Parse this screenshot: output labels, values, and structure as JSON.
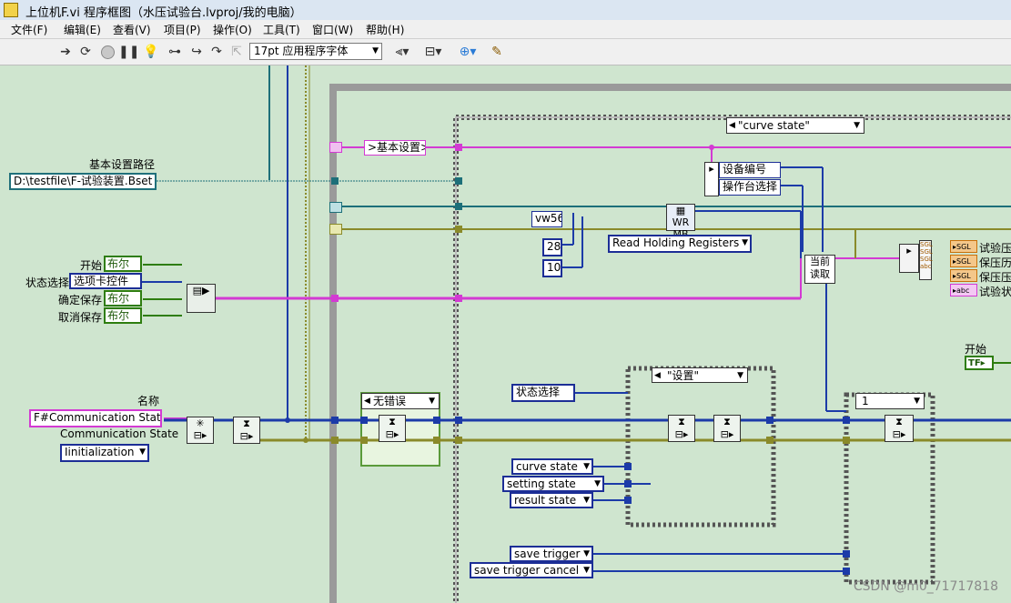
{
  "window": {
    "title": "上位机F.vi 程序框图（水压试验台.lvproj/我的电脑）"
  },
  "menu": [
    "文件(F)",
    "编辑(E)",
    "查看(V)",
    "项目(P)",
    "操作(O)",
    "工具(T)",
    "窗口(W)",
    "帮助(H)"
  ],
  "toolbar": {
    "font_select": "17pt 应用程序字体",
    "icons": [
      "run-arrow-icon",
      "run-continuous-icon",
      "abort-icon",
      "pause-icon",
      "highlight-execution-icon",
      "retain-wire-values-icon",
      "step-into-icon",
      "step-over-icon",
      "step-out-icon",
      "align-icon",
      "distribute-icon",
      "reorder-icon",
      "cleanup-icon"
    ]
  },
  "diagram": {
    "basic_path_label": "基本设置路径",
    "basic_path_value": "D:\\testfile\\F-试验装置.Bset",
    "start_label": "开始",
    "state_select_label": "状态选择",
    "confirm_save_label": "确定保存",
    "cancel_save_label": "取消保存",
    "bool_text": "布尔",
    "tab_control_text": "选项卡控件",
    "name_label": "名称",
    "name_value": "F#Communication State",
    "comm_state_label": "Communication State",
    "comm_state_value": "Iinitialization",
    "case_curve_state": "\"curve state\"",
    "basic_setting_tag": ">基本设置>",
    "device_number": "设备编号",
    "console_select": "操作台选择",
    "vw_const": "vw56",
    "num_28": "28",
    "num_10": "10",
    "modbus_func": "Read Holding Registers",
    "current_read_1": "当前",
    "current_read_2": "读取",
    "test_pressure": "试验压",
    "hold_pressure_1": "保压历",
    "hold_pressure_2": "保压压",
    "test_state": "试验状",
    "start_right": "开始",
    "no_error_case": "无错误",
    "state_select_ref": "状态选择",
    "setting_case": "\"设置\"",
    "curve_state": "curve state",
    "setting_state": "setting state",
    "result_state": "result state",
    "save_trigger": "save trigger",
    "save_trigger_cancel": "save trigger cancel",
    "case_one": "1",
    "watermark": "CSDN @m0_71717818"
  }
}
